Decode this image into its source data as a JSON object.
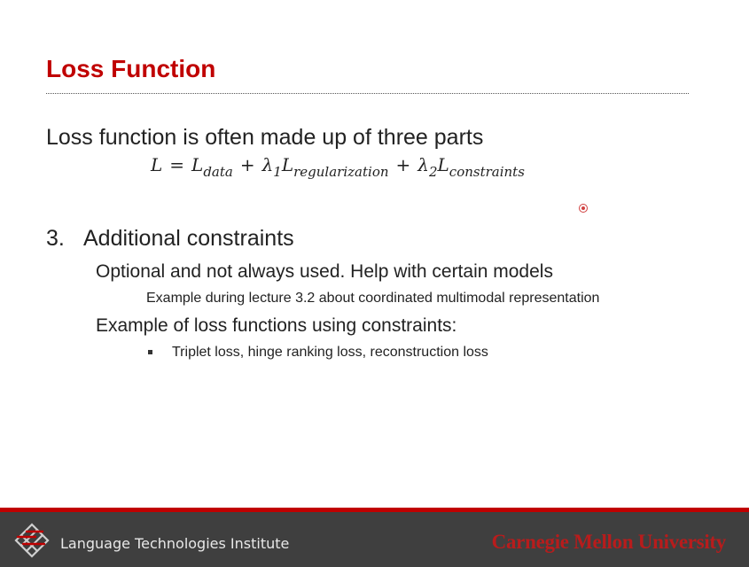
{
  "slide": {
    "title": "Loss Function",
    "intro": "Loss function is often made up of three parts",
    "equation": {
      "lhs": "L",
      "eq": "=",
      "t1": "L",
      "t1_sub": "data",
      "plus1": "+",
      "lambda1": "λ",
      "lambda1_sub": "1",
      "t2": "L",
      "t2_sub": "regularization",
      "plus2": "+",
      "lambda2": "λ",
      "lambda2_sub": "2",
      "t3": "L",
      "t3_sub": "constraints"
    },
    "section_number": "3.",
    "section_title": "Additional constraints",
    "point1": "Optional and not always used. Help with certain models",
    "point1_detail": "Example during lecture 3.2 about coordinated multimodal representation",
    "point2": "Example of loss functions using constraints:",
    "point2_bullet": "Triplet loss, hinge ranking loss, reconstruction loss"
  },
  "footer": {
    "institute": "Language Technologies Institute",
    "university": "Carnegie Mellon University",
    "logo_icon": "lti-logo-icon"
  },
  "colors": {
    "title": "#c00000",
    "footer_bg": "#3f3f3f",
    "footer_stripe": "#c00000",
    "cmu_red": "#b81c1c"
  }
}
